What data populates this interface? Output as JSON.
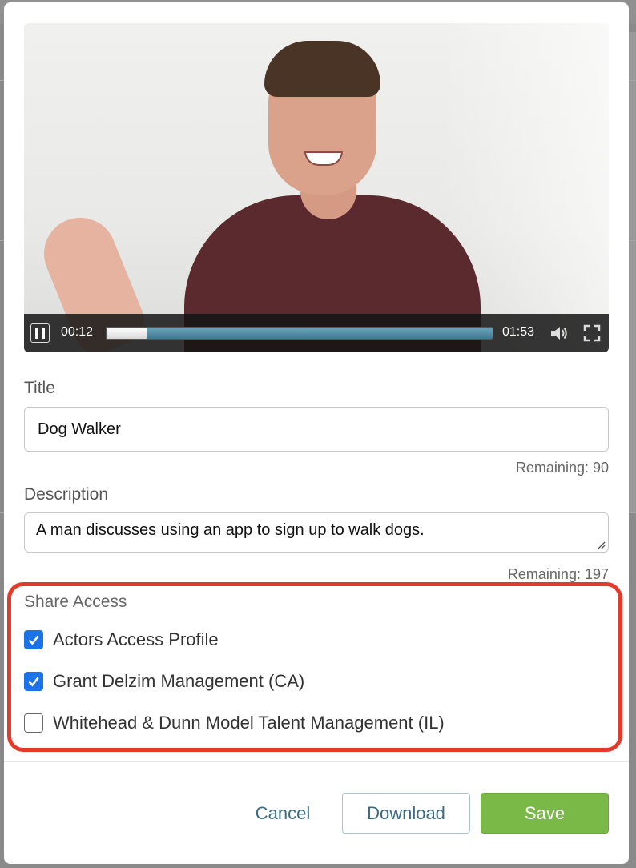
{
  "video": {
    "current_time": "00:12",
    "total_time": "01:53",
    "progress_fraction": 0.106
  },
  "form": {
    "title_label": "Title",
    "title_value": "Dog Walker",
    "title_remaining": "Remaining: 90",
    "description_label": "Description",
    "description_value": "A man discusses using an app to sign up to walk dogs.",
    "description_remaining": "Remaining: 197"
  },
  "share": {
    "label": "Share Access",
    "options": [
      {
        "label": "Actors Access Profile",
        "checked": true
      },
      {
        "label": "Grant Delzim Management (CA)",
        "checked": true
      },
      {
        "label": "Whitehead & Dunn Model Talent Management (IL)",
        "checked": false
      }
    ]
  },
  "buttons": {
    "cancel": "Cancel",
    "download": "Download",
    "save": "Save"
  },
  "colors": {
    "checkbox_on": "#1a73e8",
    "highlight_border": "#e53a2a",
    "save_bg": "#7ab847",
    "link": "#3b6a84"
  }
}
